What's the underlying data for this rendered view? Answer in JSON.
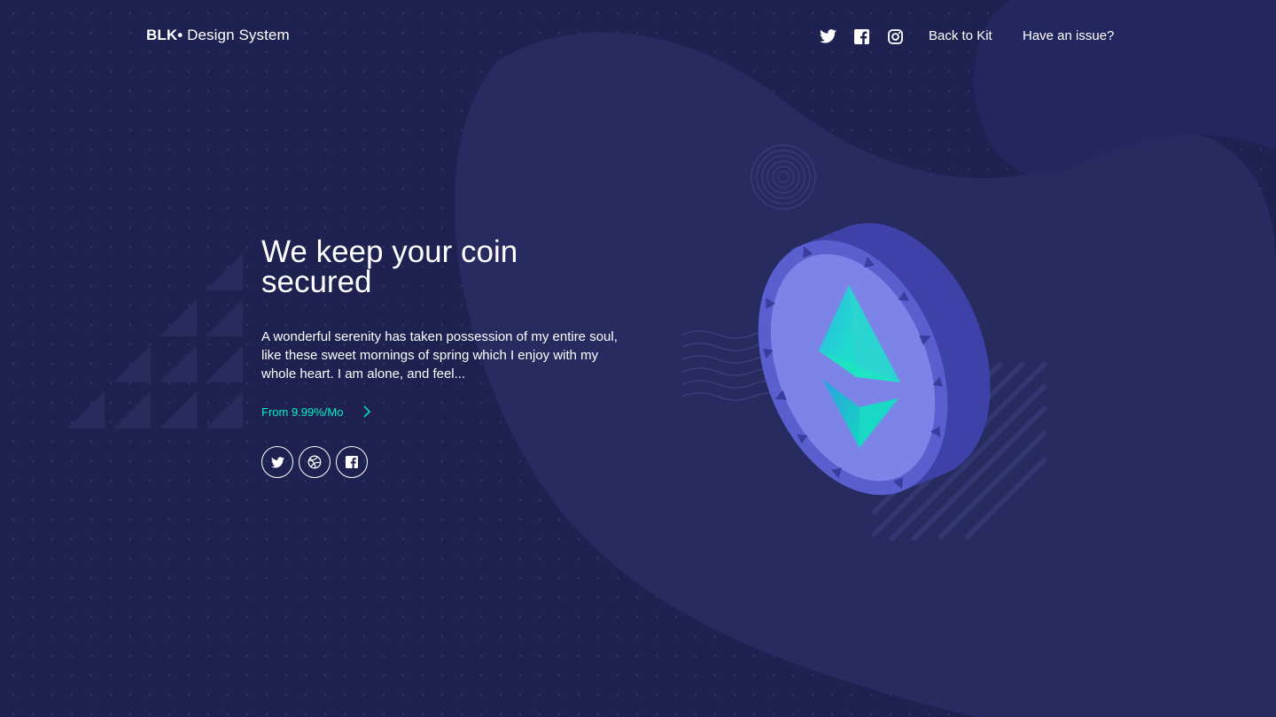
{
  "navbar": {
    "brand_bold": "BLK•",
    "brand_rest": " Design System",
    "icons": [
      "twitter-icon",
      "facebook-icon",
      "instagram-icon"
    ],
    "back_to_kit": "Back to Kit",
    "have_issue": "Have an issue?"
  },
  "hero": {
    "title": "We keep your coin secured",
    "description": "A wonderful serenity has taken possession of my entire soul, like these sweet mornings of spring which I enjoy with my whole heart. I am alone, and feel...",
    "price_link": "From 9.99%/Mo",
    "social_icons": [
      "twitter-icon",
      "dribbble-icon",
      "facebook-icon"
    ]
  },
  "colors": {
    "background": "#1f2251",
    "blob": "#2a2d62",
    "accent": "#00f2c3",
    "coin_face": "#7c84e8",
    "coin_rim": "#5a5fcf"
  }
}
